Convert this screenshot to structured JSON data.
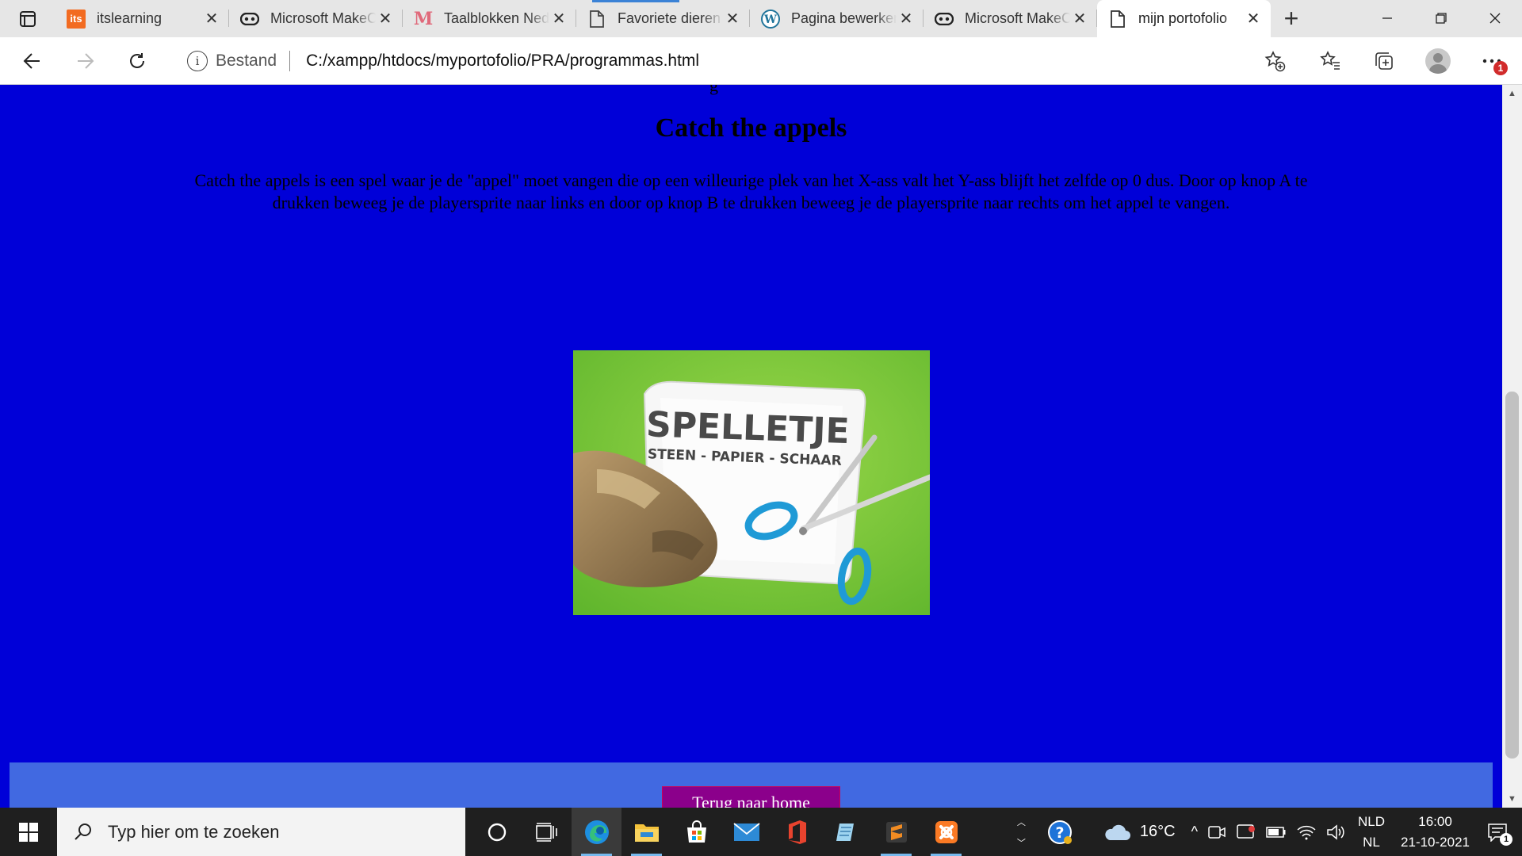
{
  "browser": {
    "tabs": [
      {
        "title": "itslearning",
        "favicon": "itslearning-icon",
        "active": false
      },
      {
        "title": "Microsoft MakeCode",
        "favicon": "makecode-icon",
        "active": false
      },
      {
        "title": "Taalblokken Nederlands",
        "favicon": "m-logo-icon",
        "active": false
      },
      {
        "title": "Favoriete dieren",
        "favicon": "page-icon",
        "active": false
      },
      {
        "title": "Pagina bewerken",
        "favicon": "wordpress-icon",
        "active": false
      },
      {
        "title": "Microsoft MakeCode",
        "favicon": "makecode-icon",
        "active": false
      },
      {
        "title": "mijn portofolio",
        "favicon": "page-icon",
        "active": true
      }
    ],
    "address": {
      "label": "Bestand",
      "url": "C:/xampp/htdocs/myportofolio/PRA/programmas.html"
    },
    "notification_count": "1"
  },
  "page": {
    "title": "Catch the appels",
    "description": "Catch the appels is een spel waar je de \"appel\" moet vangen die op een willeurige plek van het X-ass valt het Y-ass blijft het zelfde op 0 dus. Door op knop A te drukken beweeg je de playersprite naar links en door op knop B te drukken beweeg je de playersprite naar rechts om het appel te vangen.",
    "image": {
      "heading": "SPELLETJE",
      "subheading": "STEEN - PAPIER - SCHAAR"
    },
    "home_button": "Terug naar home",
    "cut_text": "g",
    "colors": {
      "background": "#0000d8",
      "footer": "#4169e1",
      "button": "#8b008b"
    }
  },
  "taskbar": {
    "search_placeholder": "Typ hier om te zoeken",
    "weather": "16°C",
    "lang_top": "NLD",
    "lang_bottom": "NL",
    "time": "16:00",
    "date": "21-10-2021"
  }
}
